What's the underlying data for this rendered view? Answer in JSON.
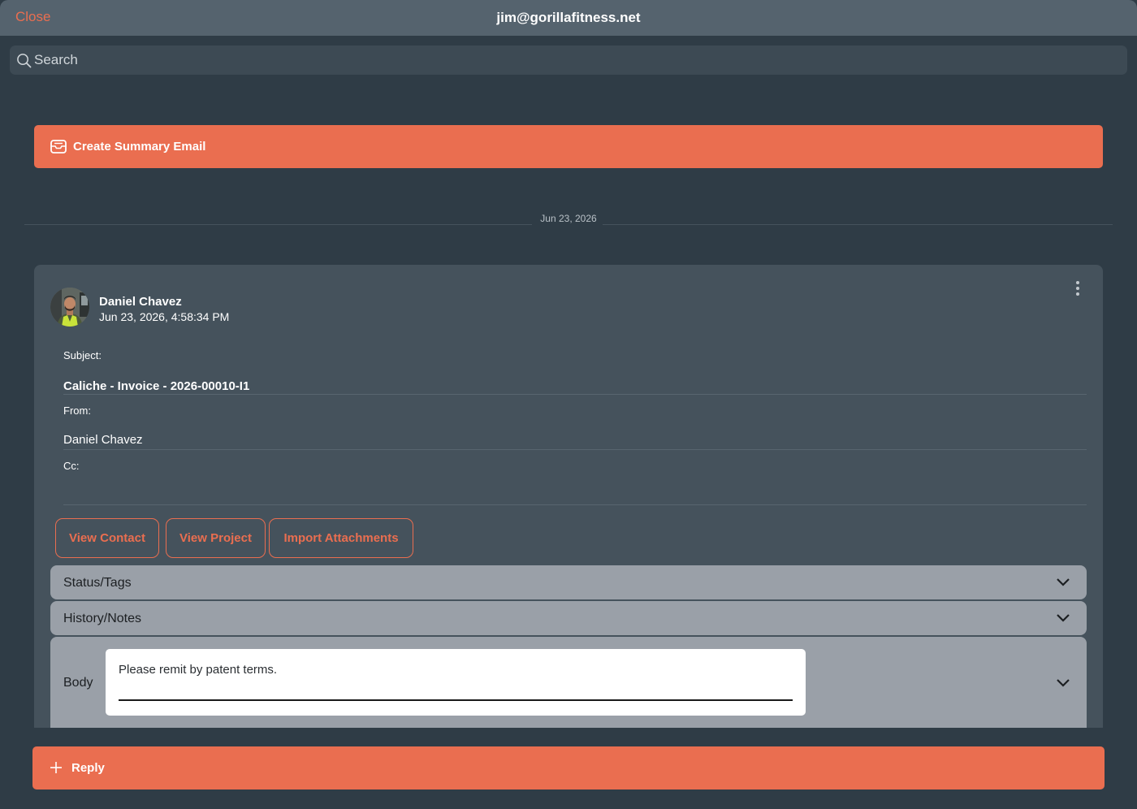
{
  "header": {
    "close_label": "Close",
    "title": "jim@gorillafitness.net"
  },
  "search": {
    "placeholder": "Search",
    "icon": "search-icon"
  },
  "summary_button": {
    "label": "Create Summary Email",
    "icon": "inbox-icon"
  },
  "date_divider": "Jun 23, 2026",
  "email": {
    "sender_name": "Daniel Chavez",
    "sent_at": "Jun 23, 2026, 4:58:34 PM",
    "subject_label": "Subject:",
    "subject": "Caliche - Invoice - 2026-00010-I1",
    "from_label": "From:",
    "from": "Daniel Chavez",
    "cc_label": "Cc:",
    "cc": "",
    "actions": {
      "view_contact": "View Contact",
      "view_project": "View Project",
      "import_attachments": "Import Attachments"
    },
    "sections": {
      "status_tags": "Status/Tags",
      "history_notes": "History/Notes",
      "body": "Body"
    },
    "body_text": "Please remit by patent terms."
  },
  "reply_button": {
    "label": "Reply",
    "icon": "plus-icon"
  },
  "colors": {
    "accent": "#ea6e50",
    "background": "#2f3c46",
    "card": "#45525c",
    "accordion": "#9aa0a8"
  }
}
